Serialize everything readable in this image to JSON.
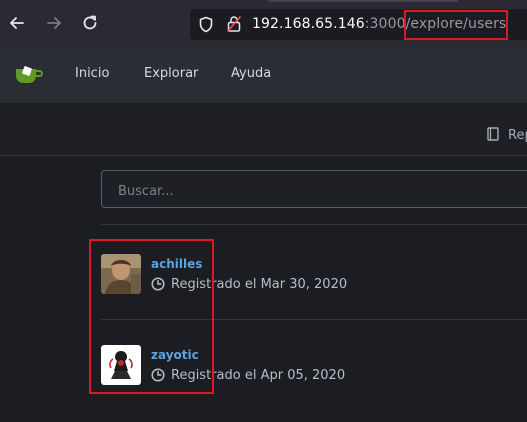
{
  "browser": {
    "back_icon": "arrow-left-icon",
    "forward_icon": "arrow-right-icon",
    "reload_icon": "reload-icon",
    "url_host": "192.168.65.146",
    "url_port": ":3000",
    "url_path": "/explore/users"
  },
  "nav": {
    "items": [
      {
        "label": "Inicio"
      },
      {
        "label": "Explorar"
      },
      {
        "label": "Ayuda"
      }
    ]
  },
  "subbar": {
    "repo_label": "Rep"
  },
  "search": {
    "placeholder": "Buscar..."
  },
  "users": [
    {
      "name": "achilles",
      "registered": "Registrado el Mar 30, 2020"
    },
    {
      "name": "zayotic",
      "registered": "Registrado el Apr 05, 2020"
    }
  ],
  "colors": {
    "accent_link": "#5fa2dd",
    "highlight_box": "#e0181f",
    "logo_green": "#609926"
  }
}
